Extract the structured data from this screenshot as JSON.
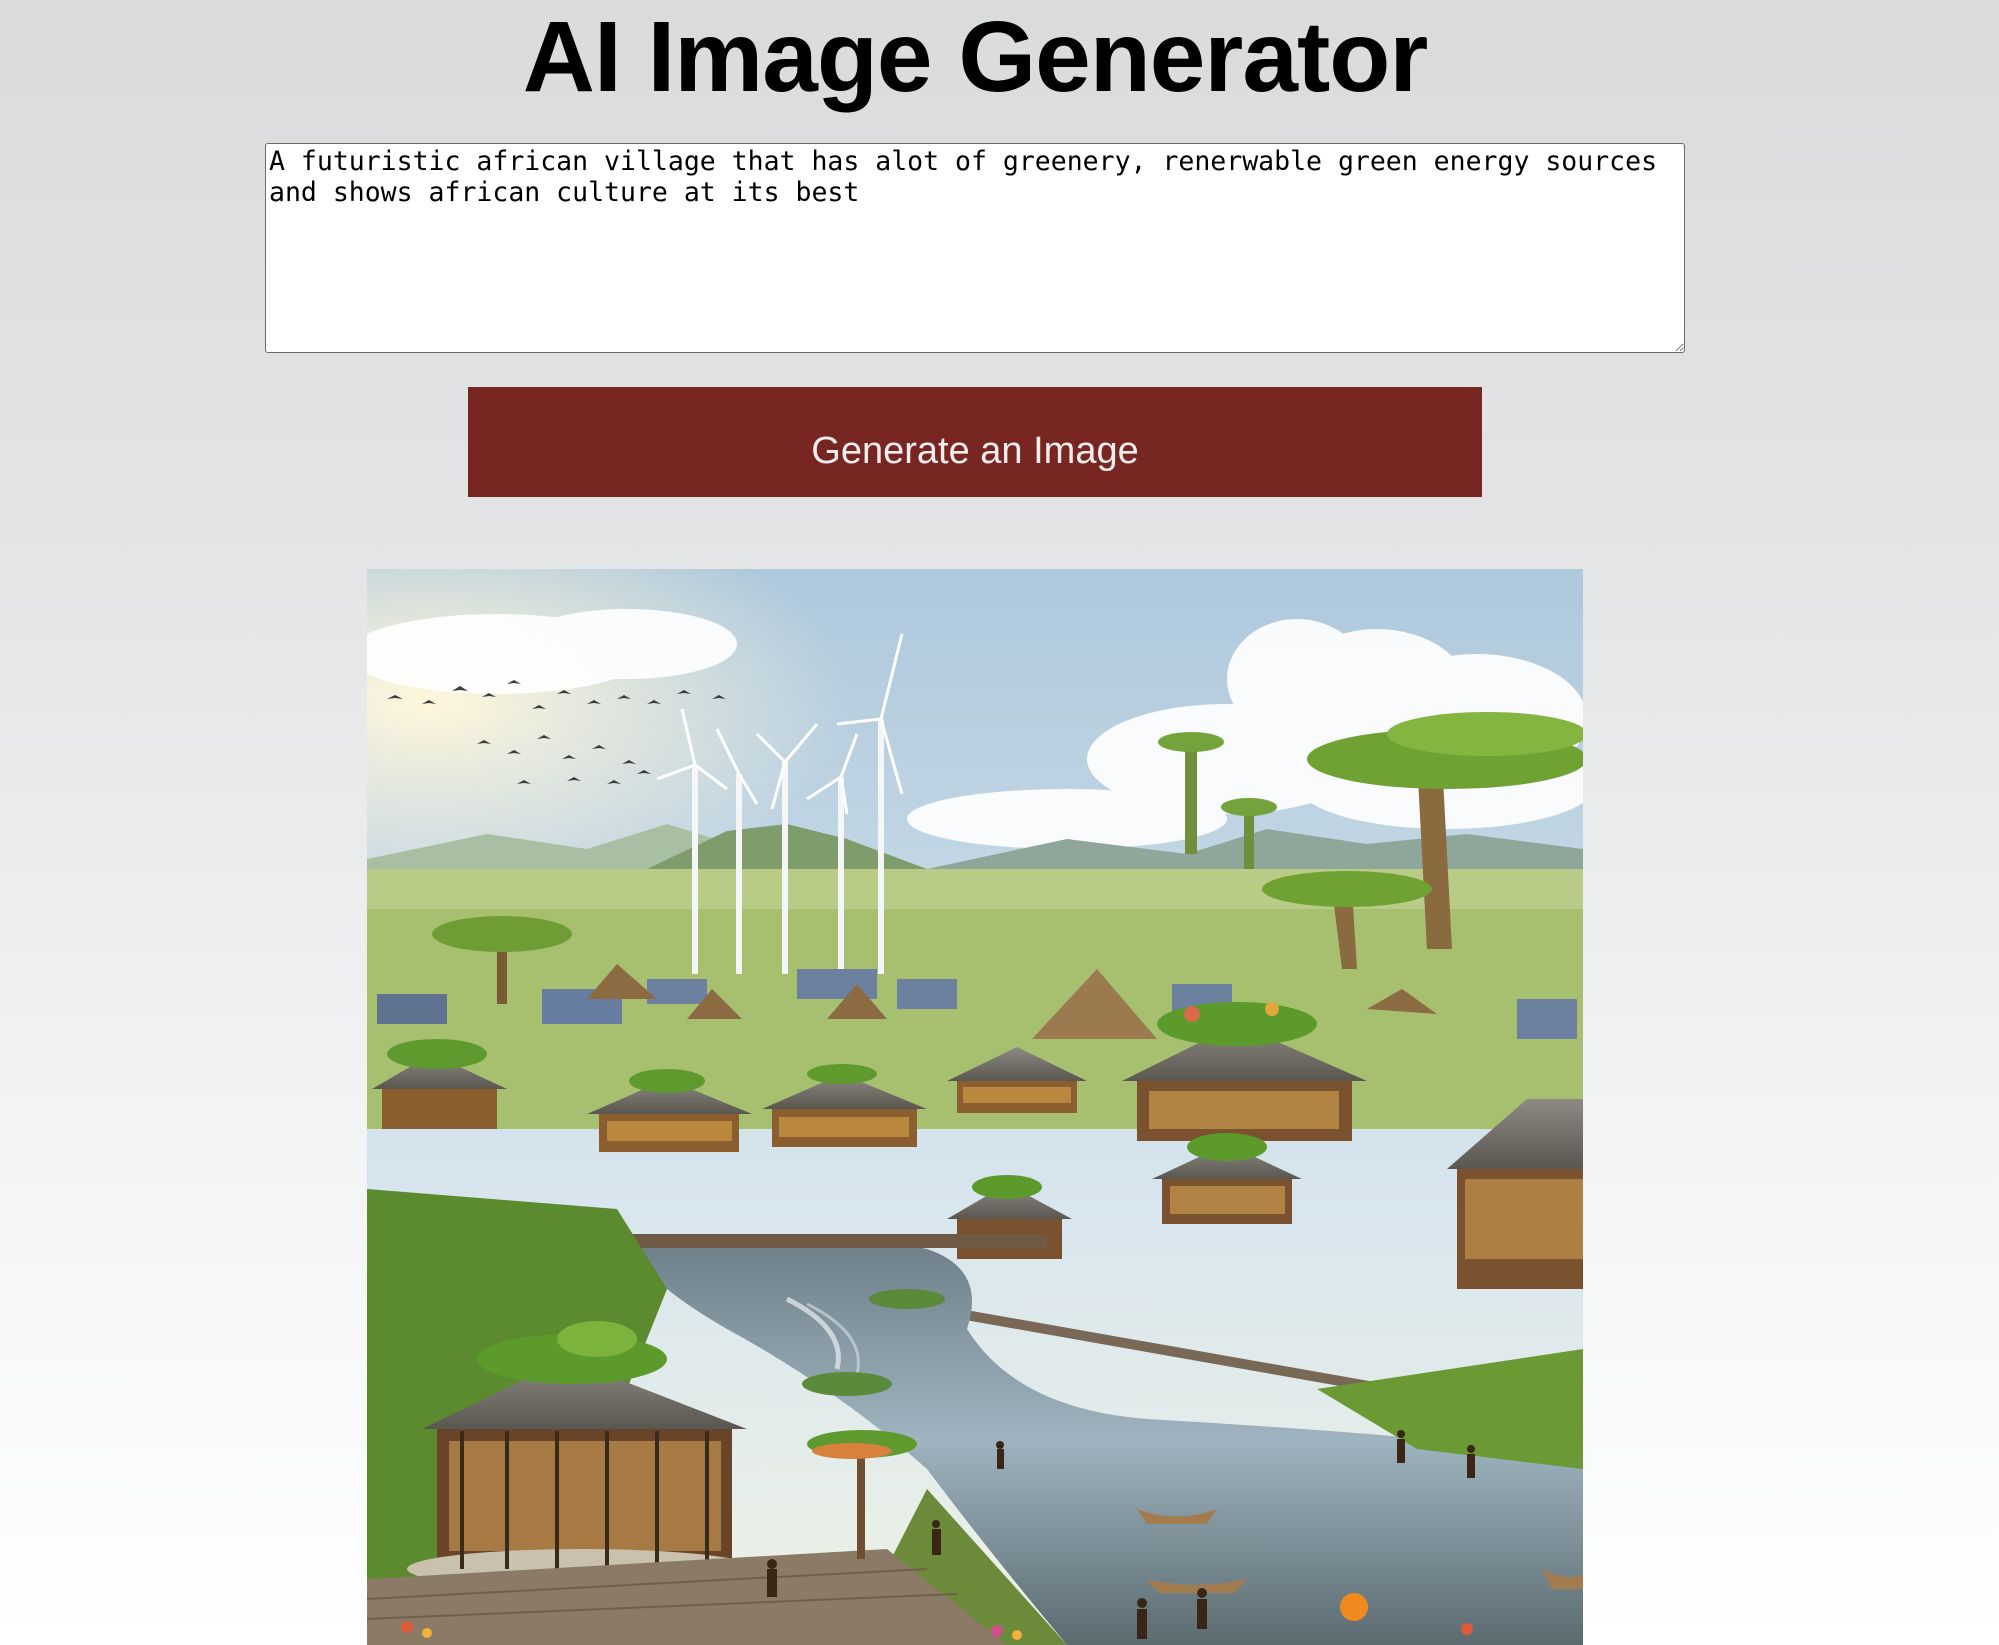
{
  "page": {
    "title": "AI Image Generator"
  },
  "prompt": {
    "value": "A futuristic african village that has alot of greenery, renerwable green energy sources and shows african culture at its best"
  },
  "generate_button": {
    "label": "Generate an Image",
    "color": "#772622"
  },
  "result_image": {
    "icon": "generated-image"
  }
}
